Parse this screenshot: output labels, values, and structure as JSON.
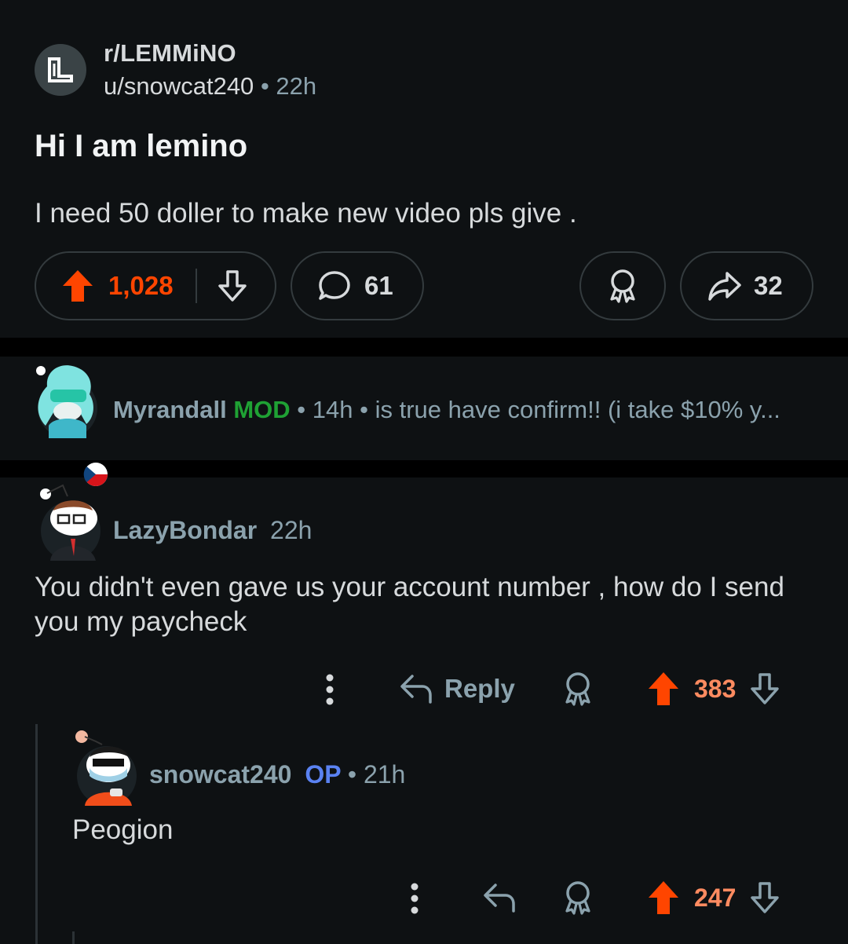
{
  "post": {
    "subreddit": "r/LEMMiNO",
    "author": "u/snowcat240",
    "separator": "•",
    "time": "22h",
    "title": "Hi I am lemino",
    "body": "I need 50 doller to make new video pls give .",
    "votes": "1,028",
    "comments": "61",
    "shares": "32"
  },
  "collapsed_comment": {
    "author": "Myrandall",
    "flair": "MOD",
    "separator": "•",
    "time": "14h",
    "preview": "is true have confirm!! (i take $10% y..."
  },
  "comment": {
    "author": "LazyBondar",
    "time": "22h",
    "body": "You didn't even gave us your account number , how do I send you my paycheck",
    "reply_label": "Reply",
    "score": "383"
  },
  "reply": {
    "author": "snowcat240",
    "flair": "OP",
    "separator": "•",
    "time": "21h",
    "body": "Peogion",
    "score": "247"
  },
  "colors": {
    "background": "#0e1113",
    "upvote": "#ff4500",
    "score": "#ff8b60",
    "mod": "#1fa134",
    "op": "#5a82f2",
    "muted": "#8ba2ad"
  },
  "icons": [
    "subreddit-icon",
    "upvote-icon",
    "downvote-icon",
    "comment-icon",
    "award-icon",
    "share-icon",
    "more-icon",
    "reply-icon",
    "avatar",
    "flag-icon"
  ]
}
